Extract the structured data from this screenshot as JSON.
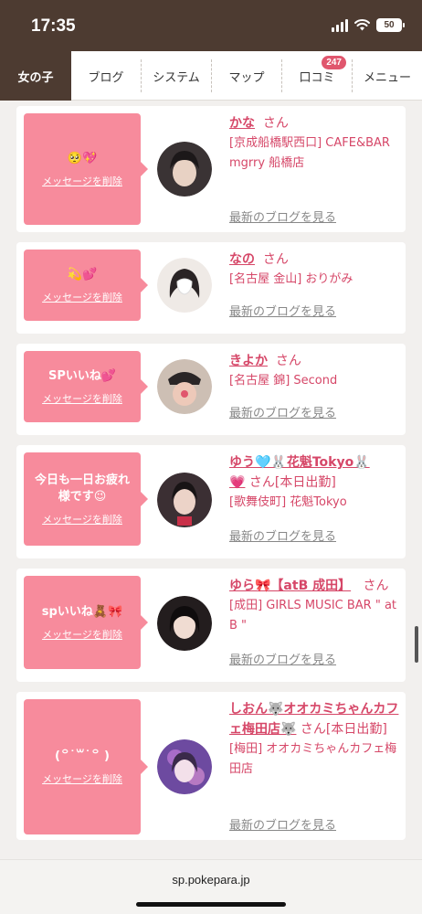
{
  "status": {
    "time": "17:35",
    "battery": "50"
  },
  "nav": {
    "tabs": [
      {
        "label": "女の子",
        "active": true
      },
      {
        "label": "ブログ"
      },
      {
        "label": "システム"
      },
      {
        "label": "マップ"
      },
      {
        "label": "口コミ",
        "badge": "247"
      },
      {
        "label": "メニュー"
      }
    ]
  },
  "delete_label": "メッセージを削除",
  "san_label": "さん",
  "blog_label": "最新のブログを見る",
  "cards": [
    {
      "message": "🥺💖",
      "name": "かな",
      "san_suffix": "",
      "shop": "[京成船橋駅西口] CAFE&BAR mgrry 船橋店"
    },
    {
      "message": "💫💕",
      "name": "なの",
      "san_suffix": "",
      "shop": "[名古屋 金山] おりがみ"
    },
    {
      "message": "SPいいね💕",
      "name": "きよか",
      "san_suffix": "",
      "shop": "[名古屋 錦] Second"
    },
    {
      "message": "今日も一日お疲れ様です😉",
      "name": "ゆう🩵🐰花魁Tokyo🐰💗",
      "san_suffix": "[本日出勤]",
      "shop": "[歌舞伎町] 花魁Tokyo"
    },
    {
      "message": "spいいね🧸🎀",
      "name": "ゆら🎀【atB 成田】",
      "san_suffix": "",
      "shop": "[成田] GIRLS MUSIC BAR \" at B \""
    },
    {
      "message": "(꒪˙꒳˙꒪ )",
      "name": "しおん🐺オオカミちゃんカフェ梅田店🐺",
      "san_suffix": "[本日出勤]",
      "shop": "[梅田] オオカミちゃんカフェ梅田店"
    }
  ],
  "bottom": {
    "url": "sp.pokepara.jp"
  }
}
